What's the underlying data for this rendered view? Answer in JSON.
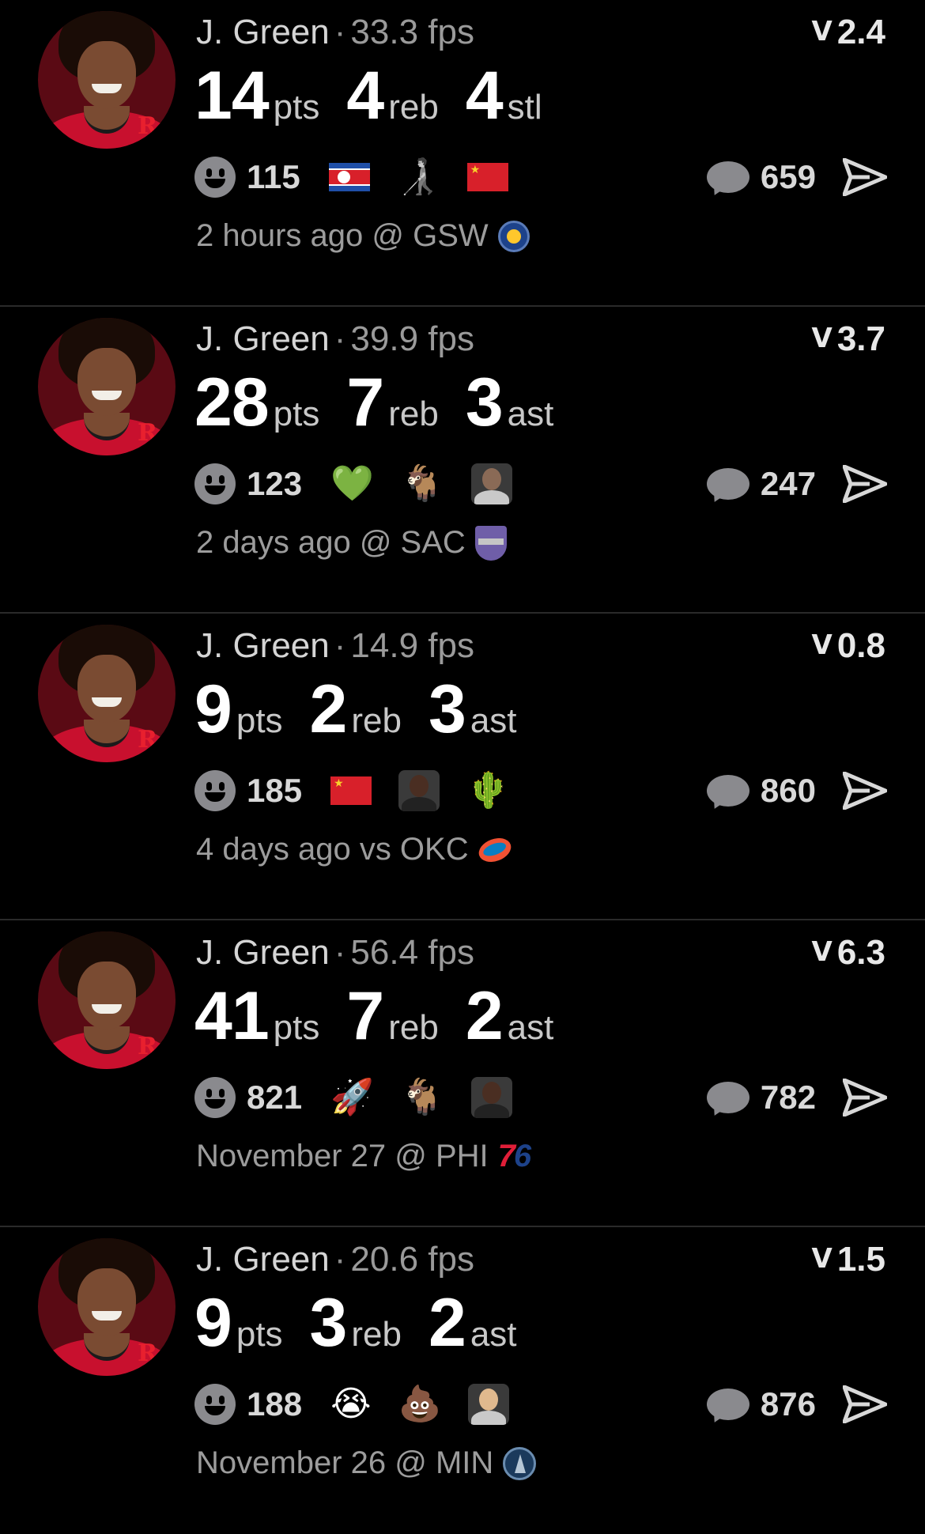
{
  "posts": [
    {
      "player": "J. Green",
      "fps": "33.3 fps",
      "rating": "2.4",
      "stats": [
        {
          "value": "14",
          "unit": "pts"
        },
        {
          "value": "4",
          "unit": "reb"
        },
        {
          "value": "4",
          "unit": "stl"
        }
      ],
      "reaction_count": "115",
      "reactions": [
        "north-korea-flag",
        "walker-icon",
        "china-flag"
      ],
      "comment_count": "659",
      "meta": "2 hours ago @ GSW",
      "team_logo": "warriors-logo"
    },
    {
      "player": "J. Green",
      "fps": "39.9 fps",
      "rating": "3.7",
      "stats": [
        {
          "value": "28",
          "unit": "pts"
        },
        {
          "value": "7",
          "unit": "reb"
        },
        {
          "value": "3",
          "unit": "ast"
        }
      ],
      "reaction_count": "123",
      "reactions": [
        "green-heart-icon",
        "goat-icon",
        "player-photo"
      ],
      "comment_count": "247",
      "meta": "2 days ago @ SAC",
      "team_logo": "kings-logo"
    },
    {
      "player": "J. Green",
      "fps": "14.9 fps",
      "rating": "0.8",
      "stats": [
        {
          "value": "9",
          "unit": "pts"
        },
        {
          "value": "2",
          "unit": "reb"
        },
        {
          "value": "3",
          "unit": "ast"
        }
      ],
      "reaction_count": "185",
      "reactions": [
        "china-flag",
        "player-photo",
        "cactus-icon"
      ],
      "comment_count": "860",
      "meta": "4 days ago vs OKC",
      "team_logo": "thunder-logo"
    },
    {
      "player": "J. Green",
      "fps": "56.4 fps",
      "rating": "6.3",
      "stats": [
        {
          "value": "41",
          "unit": "pts"
        },
        {
          "value": "7",
          "unit": "reb"
        },
        {
          "value": "2",
          "unit": "ast"
        }
      ],
      "reaction_count": "821",
      "reactions": [
        "rocket-icon",
        "goat-icon",
        "player-photo"
      ],
      "comment_count": "782",
      "meta": "November 27 @ PHI",
      "team_logo": "sixers-logo"
    },
    {
      "player": "J. Green",
      "fps": "20.6 fps",
      "rating": "1.5",
      "stats": [
        {
          "value": "9",
          "unit": "pts"
        },
        {
          "value": "3",
          "unit": "reb"
        },
        {
          "value": "2",
          "unit": "ast"
        }
      ],
      "reaction_count": "188",
      "reactions": [
        "crying-face-icon",
        "poop-icon",
        "player-photo"
      ],
      "comment_count": "876",
      "meta": "November 26 @ MIN",
      "team_logo": "timberwolves-logo"
    }
  ],
  "team_labels": {
    "phi": "7",
    "phi_b": "6"
  }
}
